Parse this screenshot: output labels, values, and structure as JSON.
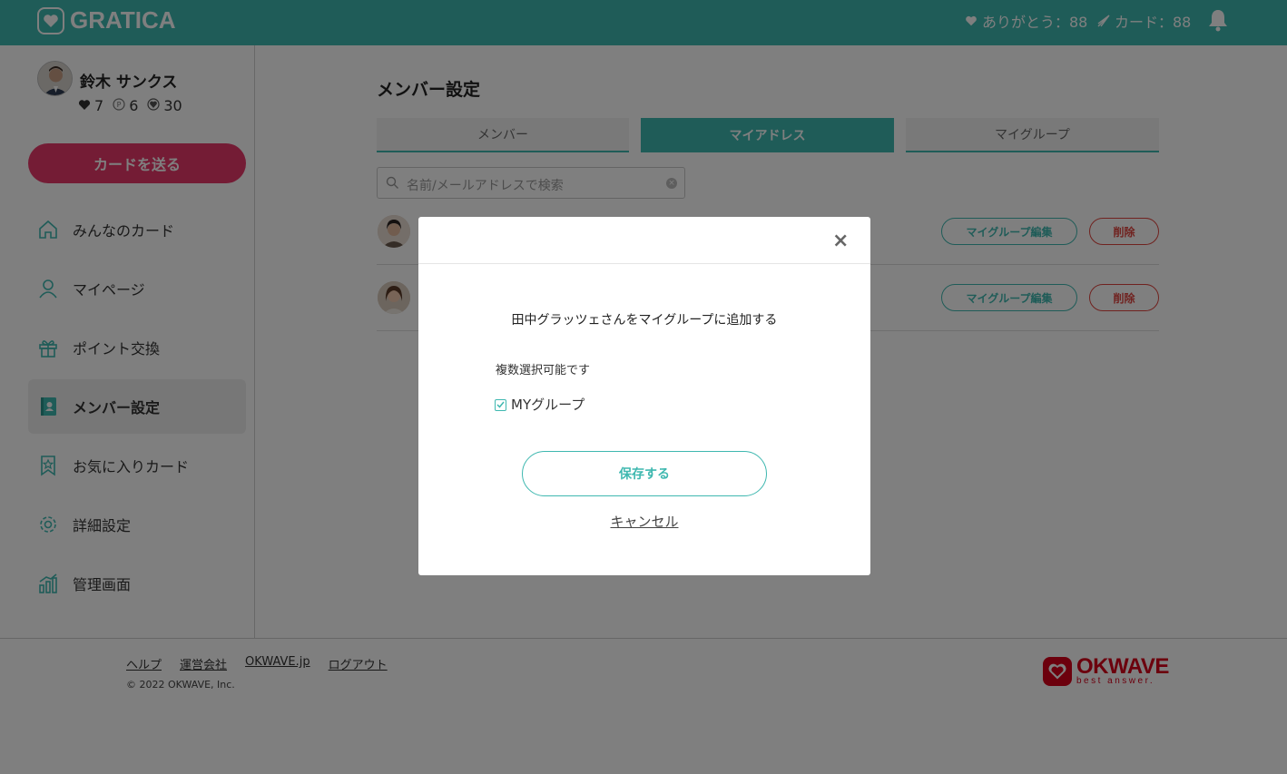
{
  "colors": {
    "brand": "#3fb8b0",
    "accent_pink": "#e8386b",
    "danger": "#e0443f",
    "okwave_red": "#d9001b"
  },
  "header": {
    "logo_text": "GRATICA",
    "thanks_label": "ありがとう：88",
    "cards_label": "カード：88",
    "icons": [
      "heart-icon",
      "paper-plane-icon",
      "bell-icon"
    ]
  },
  "user": {
    "name": "鈴木 サンクス",
    "hearts": "7",
    "points": "6",
    "badges": "30"
  },
  "sidebar": {
    "send_button": "カードを送る",
    "items": [
      {
        "label": "みんなのカード",
        "icon": "home-icon"
      },
      {
        "label": "マイページ",
        "icon": "person-icon"
      },
      {
        "label": "ポイント交換",
        "icon": "gift-icon"
      },
      {
        "label": "メンバー設定",
        "icon": "address-book-icon",
        "active": true
      },
      {
        "label": "お気に入りカード",
        "icon": "star-bookmark-icon"
      },
      {
        "label": "詳細設定",
        "icon": "gear-icon"
      },
      {
        "label": "管理画面",
        "icon": "chart-icon"
      }
    ]
  },
  "main": {
    "title": "メンバー設定",
    "tabs": [
      {
        "label": "メンバー"
      },
      {
        "label": "マイアドレス",
        "active": true
      },
      {
        "label": "マイグループ"
      }
    ],
    "search": {
      "placeholder": "名前/メールアドレスで検索"
    },
    "rows": [
      {
        "edit_label": "マイグループ編集",
        "delete_label": "削除"
      },
      {
        "edit_label": "マイグループ編集",
        "delete_label": "削除"
      }
    ]
  },
  "footer": {
    "links": [
      "ヘルプ",
      "運営会社",
      "OKWAVE.jp",
      "ログアウト"
    ],
    "copyright": "© 2022 OKWAVE, Inc.",
    "brand_name": "OKWAVE",
    "brand_tagline": "best answer."
  },
  "modal": {
    "close": "×",
    "title": "田中グラッツェさんをマイグループに追加する",
    "note": "複数選択可能です",
    "option_label": "MYグループ",
    "option_checked": true,
    "save_label": "保存する",
    "cancel_label": "キャンセル"
  }
}
